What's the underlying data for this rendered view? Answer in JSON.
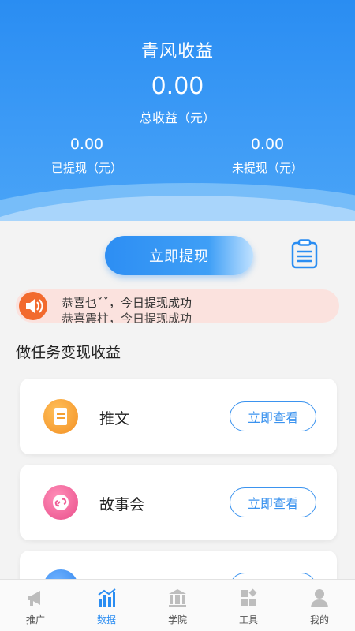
{
  "header": {
    "title": "青风收益",
    "total_value": "0.00",
    "total_label": "总收益（元）",
    "withdrawn_value": "0.00",
    "withdrawn_label": "已提现（元）",
    "unwithdrawn_value": "0.00",
    "unwithdrawn_label": "未提现（元）"
  },
  "actions": {
    "withdraw_label": "立即提现",
    "record_icon": "clipboard-icon"
  },
  "notice": {
    "icon": "speaker-icon",
    "line1": "恭喜乜ˇˇ，今日提现成功",
    "line2": "恭喜震柱，今日提现成功"
  },
  "tasks": {
    "section_title": "做任务变现收益",
    "items": [
      {
        "name": "推文",
        "button": "立即查看",
        "icon": "document-icon",
        "color": "#f5a030"
      },
      {
        "name": "故事会",
        "button": "立即查看",
        "icon": "link-icon",
        "color": "#ef5d96"
      },
      {
        "name": "",
        "button": "",
        "icon": "app-icon",
        "color": "#3d8ff0"
      }
    ]
  },
  "nav": {
    "items": [
      {
        "label": "推广",
        "icon": "megaphone-icon"
      },
      {
        "label": "数据",
        "icon": "bar-chart-icon"
      },
      {
        "label": "学院",
        "icon": "building-icon"
      },
      {
        "label": "工具",
        "icon": "tools-icon"
      },
      {
        "label": "我的",
        "icon": "user-icon"
      }
    ],
    "active": "数据"
  },
  "colors": {
    "primary": "#2a8df2",
    "notice_bg": "#fbe2de",
    "speaker": "#f26a2e",
    "inactive_icon": "#bdbdbd"
  }
}
